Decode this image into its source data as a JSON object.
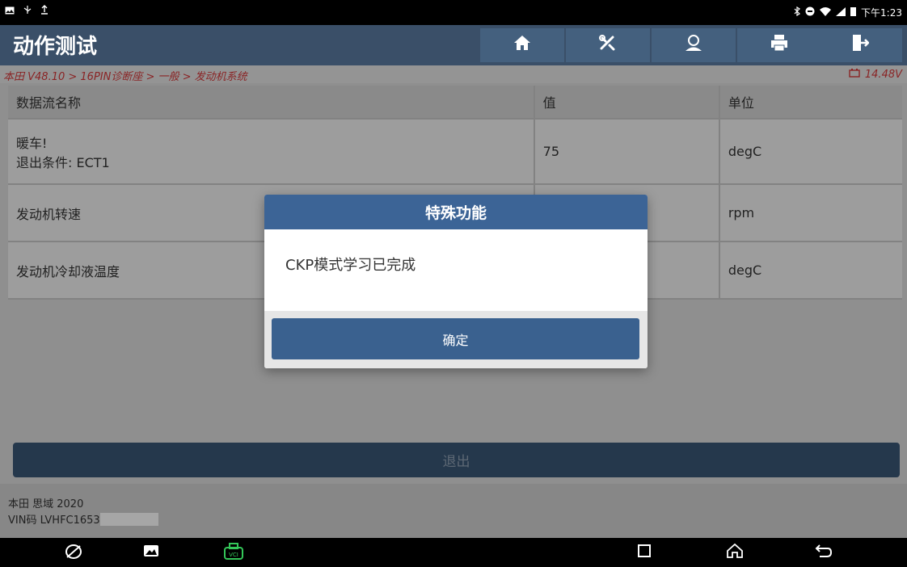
{
  "status_bar": {
    "time": "下午1:23",
    "left_icons": [
      "image-notification-icon",
      "usb-icon",
      "upload-icon"
    ],
    "right_icons": [
      "bluetooth-icon",
      "dnd-icon",
      "wifi-icon",
      "signal-icon",
      "battery-icon"
    ]
  },
  "header": {
    "title": "动作测试",
    "nav_buttons": [
      "home-icon",
      "diagnostic-tools-icon",
      "user-icon",
      "print-icon",
      "exit-icon"
    ]
  },
  "breadcrumb": {
    "path": "本田 V48.10 > 16PIN诊断座 > 一般 > 发动机系统",
    "voltage": "14.48V"
  },
  "table": {
    "headers": [
      "数据流名称",
      "值",
      "单位"
    ],
    "rows": [
      {
        "name_line1": "暖车!",
        "name_line2": "退出条件: ECT1",
        "value": "75",
        "unit": "degC"
      },
      {
        "name_line1": "发动机转速",
        "name_line2": "",
        "value": "",
        "unit": "rpm"
      },
      {
        "name_line1": "发动机冷却液温度",
        "name_line2": "",
        "value": "",
        "unit": "degC"
      }
    ]
  },
  "exit_button": "退出",
  "footer": {
    "vehicle": "本田 思域 2020",
    "vin_prefix": "VIN码 LVHFC1653"
  },
  "dialog": {
    "title": "特殊功能",
    "message": "CKP模式学习已完成",
    "ok_label": "确定"
  },
  "colors": {
    "header_bg": "#3a4f68",
    "dialog_header": "#3c6496",
    "breadcrumb_text": "#d4383a"
  }
}
